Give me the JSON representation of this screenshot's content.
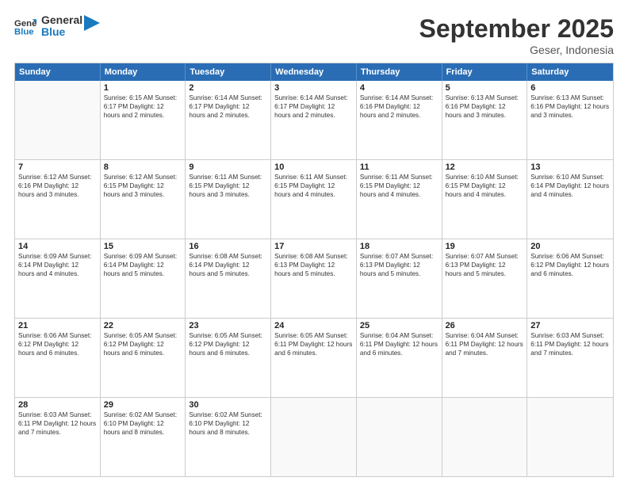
{
  "logo": {
    "line1": "General",
    "line2": "Blue"
  },
  "title": "September 2025",
  "location": "Geser, Indonesia",
  "weekdays": [
    "Sunday",
    "Monday",
    "Tuesday",
    "Wednesday",
    "Thursday",
    "Friday",
    "Saturday"
  ],
  "weeks": [
    [
      {
        "day": "",
        "info": ""
      },
      {
        "day": "1",
        "info": "Sunrise: 6:15 AM\nSunset: 6:17 PM\nDaylight: 12 hours\nand 2 minutes."
      },
      {
        "day": "2",
        "info": "Sunrise: 6:14 AM\nSunset: 6:17 PM\nDaylight: 12 hours\nand 2 minutes."
      },
      {
        "day": "3",
        "info": "Sunrise: 6:14 AM\nSunset: 6:17 PM\nDaylight: 12 hours\nand 2 minutes."
      },
      {
        "day": "4",
        "info": "Sunrise: 6:14 AM\nSunset: 6:16 PM\nDaylight: 12 hours\nand 2 minutes."
      },
      {
        "day": "5",
        "info": "Sunrise: 6:13 AM\nSunset: 6:16 PM\nDaylight: 12 hours\nand 3 minutes."
      },
      {
        "day": "6",
        "info": "Sunrise: 6:13 AM\nSunset: 6:16 PM\nDaylight: 12 hours\nand 3 minutes."
      }
    ],
    [
      {
        "day": "7",
        "info": "Sunrise: 6:12 AM\nSunset: 6:16 PM\nDaylight: 12 hours\nand 3 minutes."
      },
      {
        "day": "8",
        "info": "Sunrise: 6:12 AM\nSunset: 6:15 PM\nDaylight: 12 hours\nand 3 minutes."
      },
      {
        "day": "9",
        "info": "Sunrise: 6:11 AM\nSunset: 6:15 PM\nDaylight: 12 hours\nand 3 minutes."
      },
      {
        "day": "10",
        "info": "Sunrise: 6:11 AM\nSunset: 6:15 PM\nDaylight: 12 hours\nand 4 minutes."
      },
      {
        "day": "11",
        "info": "Sunrise: 6:11 AM\nSunset: 6:15 PM\nDaylight: 12 hours\nand 4 minutes."
      },
      {
        "day": "12",
        "info": "Sunrise: 6:10 AM\nSunset: 6:15 PM\nDaylight: 12 hours\nand 4 minutes."
      },
      {
        "day": "13",
        "info": "Sunrise: 6:10 AM\nSunset: 6:14 PM\nDaylight: 12 hours\nand 4 minutes."
      }
    ],
    [
      {
        "day": "14",
        "info": "Sunrise: 6:09 AM\nSunset: 6:14 PM\nDaylight: 12 hours\nand 4 minutes."
      },
      {
        "day": "15",
        "info": "Sunrise: 6:09 AM\nSunset: 6:14 PM\nDaylight: 12 hours\nand 5 minutes."
      },
      {
        "day": "16",
        "info": "Sunrise: 6:08 AM\nSunset: 6:14 PM\nDaylight: 12 hours\nand 5 minutes."
      },
      {
        "day": "17",
        "info": "Sunrise: 6:08 AM\nSunset: 6:13 PM\nDaylight: 12 hours\nand 5 minutes."
      },
      {
        "day": "18",
        "info": "Sunrise: 6:07 AM\nSunset: 6:13 PM\nDaylight: 12 hours\nand 5 minutes."
      },
      {
        "day": "19",
        "info": "Sunrise: 6:07 AM\nSunset: 6:13 PM\nDaylight: 12 hours\nand 5 minutes."
      },
      {
        "day": "20",
        "info": "Sunrise: 6:06 AM\nSunset: 6:12 PM\nDaylight: 12 hours\nand 6 minutes."
      }
    ],
    [
      {
        "day": "21",
        "info": "Sunrise: 6:06 AM\nSunset: 6:12 PM\nDaylight: 12 hours\nand 6 minutes."
      },
      {
        "day": "22",
        "info": "Sunrise: 6:05 AM\nSunset: 6:12 PM\nDaylight: 12 hours\nand 6 minutes."
      },
      {
        "day": "23",
        "info": "Sunrise: 6:05 AM\nSunset: 6:12 PM\nDaylight: 12 hours\nand 6 minutes."
      },
      {
        "day": "24",
        "info": "Sunrise: 6:05 AM\nSunset: 6:11 PM\nDaylight: 12 hours\nand 6 minutes."
      },
      {
        "day": "25",
        "info": "Sunrise: 6:04 AM\nSunset: 6:11 PM\nDaylight: 12 hours\nand 6 minutes."
      },
      {
        "day": "26",
        "info": "Sunrise: 6:04 AM\nSunset: 6:11 PM\nDaylight: 12 hours\nand 7 minutes."
      },
      {
        "day": "27",
        "info": "Sunrise: 6:03 AM\nSunset: 6:11 PM\nDaylight: 12 hours\nand 7 minutes."
      }
    ],
    [
      {
        "day": "28",
        "info": "Sunrise: 6:03 AM\nSunset: 6:11 PM\nDaylight: 12 hours\nand 7 minutes."
      },
      {
        "day": "29",
        "info": "Sunrise: 6:02 AM\nSunset: 6:10 PM\nDaylight: 12 hours\nand 8 minutes."
      },
      {
        "day": "30",
        "info": "Sunrise: 6:02 AM\nSunset: 6:10 PM\nDaylight: 12 hours\nand 8 minutes."
      },
      {
        "day": "",
        "info": ""
      },
      {
        "day": "",
        "info": ""
      },
      {
        "day": "",
        "info": ""
      },
      {
        "day": "",
        "info": ""
      }
    ]
  ]
}
